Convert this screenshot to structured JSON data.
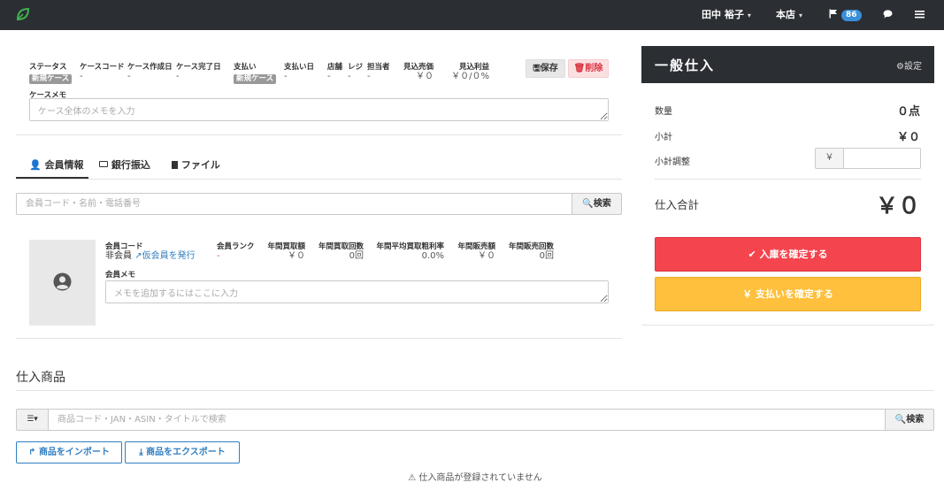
{
  "nav": {
    "user": "田中 裕子",
    "store": "本店",
    "notifications": "86",
    "colors": {
      "bar": "#2b2e33",
      "logo": "#3fb34f",
      "badge": "#3a8fd9"
    }
  },
  "case": {
    "status_label": "ステータス",
    "status_value": "新規ケース",
    "code_label": "ケースコード",
    "code_value": "-",
    "created_label": "ケース作成日",
    "created_value": "-",
    "completed_label": "ケース完了日",
    "completed_value": "-",
    "payment_label": "支払い",
    "payment_value": "新規ケース",
    "paydate_label": "支払い日",
    "paydate_value": "-",
    "store_label": "店舗",
    "store_value": "-",
    "register_label": "レジ",
    "register_value": "-",
    "staff_label": "担当者",
    "staff_value": "-",
    "expected_sales_label": "見込売価",
    "expected_sales_value": "￥０",
    "expected_profit_label": "見込利益",
    "expected_profit_value": "￥０/０%",
    "save_label": "保存",
    "delete_label": "削除",
    "memo_label": "ケースメモ",
    "memo_placeholder": "ケース全体のメモを入力"
  },
  "tabs": [
    {
      "label": "会員情報"
    },
    {
      "label": "銀行振込"
    },
    {
      "label": "ファイル"
    }
  ],
  "member_search": {
    "placeholder": "会員コード・名前・電話番号",
    "button": "検索"
  },
  "member": {
    "code_label": "会員コード",
    "code_value": "非会員",
    "temp_link": "仮会員を発行",
    "rank_label": "会員ランク",
    "rank_value": "-",
    "buy_amount_label": "年間買取額",
    "buy_amount_value": "￥０",
    "buy_count_label": "年間買取回数",
    "buy_count_value": "0回",
    "margin_label": "年間平均買取粗利率",
    "margin_value": "0.0%",
    "sales_amount_label": "年間販売額",
    "sales_amount_value": "￥０",
    "sales_count_label": "年間販売回数",
    "sales_count_value": "0回",
    "memo_label": "会員メモ",
    "memo_placeholder": "メモを追加するにはここに入力"
  },
  "panel": {
    "title": "一般仕入",
    "settings": "設定",
    "qty_label": "数量",
    "qty_value": "０点",
    "subtotal_label": "小計",
    "subtotal_value": "￥０",
    "adjust_label": "小計調整",
    "adjust_currency": "￥",
    "total_label": "仕入合計",
    "total_value": "￥０",
    "confirm_button": "入庫を確定する",
    "pay_button": "￥ 支払いを確定する",
    "colors": {
      "confirm": "#f4454f",
      "pay": "#fec03d"
    }
  },
  "products": {
    "title": "仕入商品",
    "search_placeholder": "商品コード・JAN・ASIN・タイトルで検索",
    "search_button": "検索",
    "import_button": "商品をインポート",
    "export_button": "商品をエクスポート",
    "empty_message": "仕入商品が登録されていません"
  }
}
